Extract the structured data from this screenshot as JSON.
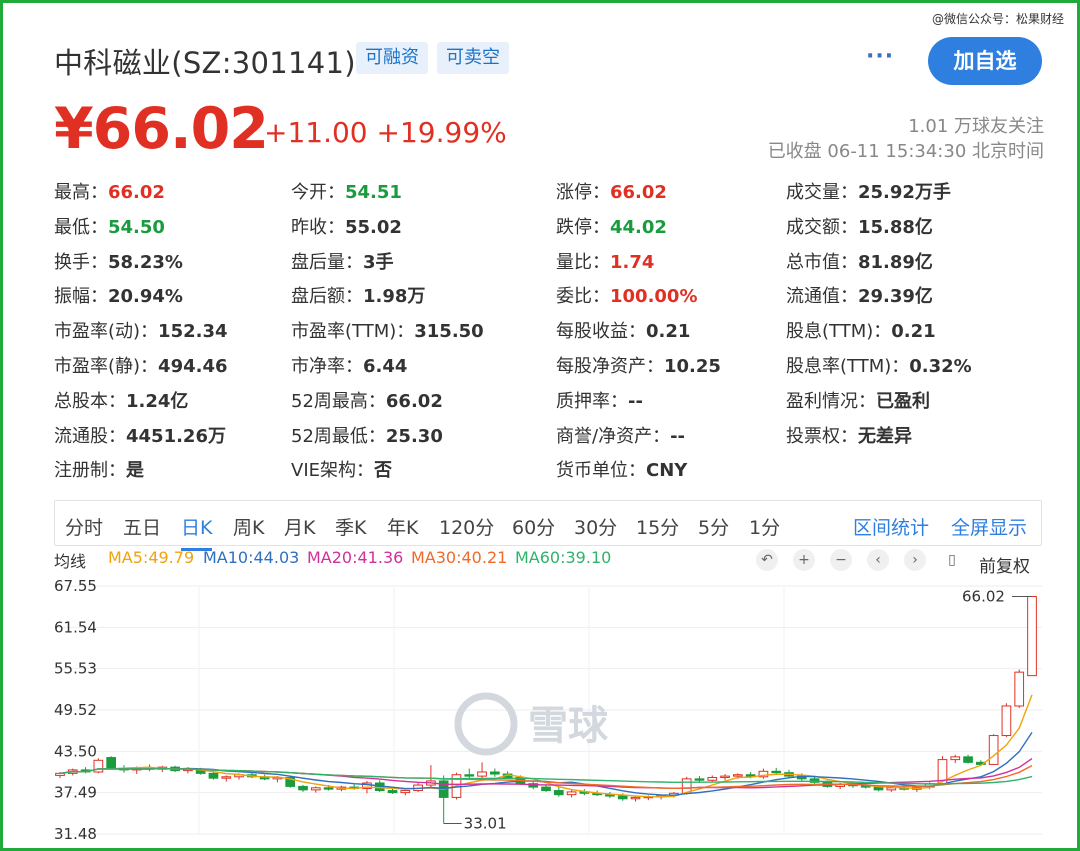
{
  "watermark_top": "@微信公众号：松果财经",
  "header": {
    "title": "中科磁业(SZ:301141)",
    "tags": [
      "可融资",
      "可卖空"
    ],
    "more_label": "···",
    "follow_label": "加自选"
  },
  "quote": {
    "price": "¥66.02",
    "change": "+11.00 +19.99%",
    "followers": "1.01 万球友关注",
    "status": "已收盘 06-11 15:34:30 北京时间"
  },
  "stats": [
    [
      {
        "label": "最高：",
        "value": "66.02",
        "color": "red"
      },
      {
        "label": "今开：",
        "value": "54.51",
        "color": "green"
      },
      {
        "label": "涨停：",
        "value": "66.02",
        "color": "red"
      },
      {
        "label": "成交量：",
        "value": "25.92万手",
        "color": ""
      }
    ],
    [
      {
        "label": "最低：",
        "value": "54.50",
        "color": "green"
      },
      {
        "label": "昨收：",
        "value": "55.02",
        "color": ""
      },
      {
        "label": "跌停：",
        "value": "44.02",
        "color": "green"
      },
      {
        "label": "成交额：",
        "value": "15.88亿",
        "color": ""
      }
    ],
    [
      {
        "label": "换手：",
        "value": "58.23%",
        "color": ""
      },
      {
        "label": "盘后量：",
        "value": "3手",
        "color": ""
      },
      {
        "label": "量比：",
        "value": "1.74",
        "color": "red"
      },
      {
        "label": "总市值：",
        "value": "81.89亿",
        "color": ""
      }
    ],
    [
      {
        "label": "振幅：",
        "value": "20.94%",
        "color": ""
      },
      {
        "label": "盘后额：",
        "value": "1.98万",
        "color": ""
      },
      {
        "label": "委比：",
        "value": "100.00%",
        "color": "red"
      },
      {
        "label": "流通值：",
        "value": "29.39亿",
        "color": ""
      }
    ],
    [
      {
        "label": "市盈率(动)：",
        "value": "152.34",
        "color": ""
      },
      {
        "label": "市盈率(TTM)：",
        "value": "315.50",
        "color": ""
      },
      {
        "label": "每股收益：",
        "value": "0.21",
        "color": ""
      },
      {
        "label": "股息(TTM)：",
        "value": "0.21",
        "color": ""
      }
    ],
    [
      {
        "label": "市盈率(静)：",
        "value": "494.46",
        "color": ""
      },
      {
        "label": "市净率：",
        "value": "6.44",
        "color": ""
      },
      {
        "label": "每股净资产：",
        "value": "10.25",
        "color": ""
      },
      {
        "label": "股息率(TTM)：",
        "value": "0.32%",
        "color": ""
      }
    ],
    [
      {
        "label": "总股本：",
        "value": "1.24亿",
        "color": ""
      },
      {
        "label": "52周最高：",
        "value": "66.02",
        "color": ""
      },
      {
        "label": "质押率：",
        "value": "--",
        "color": ""
      },
      {
        "label": "盈利情况：",
        "value": "已盈利",
        "color": ""
      }
    ],
    [
      {
        "label": "流通股：",
        "value": "4451.26万",
        "color": ""
      },
      {
        "label": "52周最低：",
        "value": "25.30",
        "color": ""
      },
      {
        "label": "商誉/净资产：",
        "value": "--",
        "color": ""
      },
      {
        "label": "投票权：",
        "value": "无差异",
        "color": ""
      }
    ],
    [
      {
        "label": "注册制：",
        "value": "是",
        "color": ""
      },
      {
        "label": "VIE架构：",
        "value": "否",
        "color": ""
      },
      {
        "label": "货币单位：",
        "value": "CNY",
        "color": ""
      }
    ]
  ],
  "periods": [
    "分时",
    "五日",
    "日K",
    "周K",
    "月K",
    "季K",
    "年K",
    "120分",
    "60分",
    "30分",
    "15分",
    "5分",
    "1分"
  ],
  "active_period": "日K",
  "tools": {
    "range_stats": "区间统计",
    "fullscreen": "全屏显示"
  },
  "ma": {
    "label": "均线",
    "items": [
      {
        "text": "MA5:49.79",
        "color": "#f0a30a"
      },
      {
        "text": "MA10:44.03",
        "color": "#2f6fc0"
      },
      {
        "text": "MA20:41.36",
        "color": "#d0309a"
      },
      {
        "text": "MA30:40.21",
        "color": "#f06a2a"
      },
      {
        "text": "MA60:39.10",
        "color": "#2fb36a"
      }
    ]
  },
  "chart_controls": {
    "icons": [
      "undo-icon",
      "zoom-in-icon",
      "zoom-out-icon",
      "prev-icon",
      "next-icon",
      "candle-icon"
    ],
    "adjust_label": "前复权"
  },
  "chart_watermark": "雪球",
  "chart_data": {
    "type": "candlestick",
    "y_ticks": [
      "67.55",
      "61.54",
      "55.53",
      "49.52",
      "43.50",
      "37.49",
      "31.48"
    ],
    "ylim": [
      31.48,
      67.55
    ],
    "annotations": [
      {
        "text": "66.02",
        "value": 66.02
      },
      {
        "text": "33.01",
        "value": 33.01
      }
    ],
    "colors": {
      "up": "#e03023",
      "down": "#1a9c3e"
    },
    "candles": [
      [
        40.0,
        40.5,
        39.6,
        40.3
      ],
      [
        40.3,
        41.0,
        40.0,
        40.8
      ],
      [
        40.8,
        41.2,
        40.3,
        40.5
      ],
      [
        40.5,
        42.5,
        40.3,
        42.2
      ],
      [
        42.6,
        42.8,
        40.9,
        41.0
      ],
      [
        41.0,
        41.5,
        40.4,
        40.8
      ],
      [
        40.8,
        41.3,
        40.2,
        41.1
      ],
      [
        41.1,
        41.6,
        40.6,
        40.9
      ],
      [
        40.9,
        41.4,
        40.5,
        41.2
      ],
      [
        41.2,
        41.4,
        40.5,
        40.7
      ],
      [
        40.7,
        41.2,
        40.3,
        40.9
      ],
      [
        40.9,
        41.1,
        40.1,
        40.3
      ],
      [
        40.3,
        40.6,
        39.4,
        39.6
      ],
      [
        39.6,
        40.0,
        39.1,
        39.8
      ],
      [
        39.8,
        40.3,
        39.4,
        40.1
      ],
      [
        40.1,
        40.5,
        39.6,
        39.8
      ],
      [
        39.8,
        40.1,
        39.3,
        39.5
      ],
      [
        39.5,
        39.9,
        39.0,
        39.7
      ],
      [
        39.7,
        39.9,
        38.2,
        38.4
      ],
      [
        38.4,
        38.6,
        37.6,
        37.9
      ],
      [
        37.9,
        38.4,
        37.5,
        38.2
      ],
      [
        38.2,
        38.6,
        37.8,
        38.0
      ],
      [
        38.0,
        38.5,
        37.7,
        38.3
      ],
      [
        38.3,
        38.7,
        37.9,
        38.1
      ],
      [
        38.1,
        39.2,
        37.4,
        38.9
      ],
      [
        38.9,
        39.3,
        37.6,
        37.8
      ],
      [
        37.8,
        38.1,
        37.3,
        37.5
      ],
      [
        37.5,
        37.9,
        37.1,
        37.8
      ],
      [
        37.8,
        38.9,
        37.6,
        38.6
      ],
      [
        38.6,
        41.5,
        38.3,
        39.2
      ],
      [
        39.2,
        40.0,
        33.01,
        36.8
      ],
      [
        36.8,
        40.4,
        36.5,
        40.1
      ],
      [
        40.1,
        41.0,
        39.4,
        39.9
      ],
      [
        39.9,
        41.9,
        39.6,
        40.5
      ],
      [
        40.5,
        41.0,
        39.8,
        40.2
      ],
      [
        40.2,
        40.6,
        39.5,
        39.7
      ],
      [
        39.7,
        40.0,
        38.6,
        38.8
      ],
      [
        38.8,
        39.2,
        38.0,
        38.3
      ],
      [
        38.3,
        38.7,
        37.6,
        37.8
      ],
      [
        37.8,
        38.4,
        36.9,
        37.2
      ],
      [
        37.2,
        37.9,
        36.8,
        37.6
      ],
      [
        37.6,
        38.0,
        37.1,
        37.4
      ],
      [
        37.4,
        37.8,
        37.0,
        37.2
      ],
      [
        37.2,
        37.6,
        36.7,
        37.0
      ],
      [
        37.0,
        37.4,
        36.3,
        36.6
      ],
      [
        36.6,
        37.0,
        36.2,
        36.8
      ],
      [
        36.8,
        37.1,
        36.4,
        36.9
      ],
      [
        36.9,
        37.2,
        36.5,
        37.1
      ],
      [
        37.1,
        37.6,
        36.8,
        37.4
      ],
      [
        37.4,
        39.8,
        37.2,
        39.5
      ],
      [
        39.5,
        39.9,
        38.9,
        39.3
      ],
      [
        39.3,
        40.0,
        39.0,
        39.7
      ],
      [
        39.7,
        40.2,
        39.3,
        39.9
      ],
      [
        39.9,
        40.3,
        39.5,
        40.1
      ],
      [
        40.1,
        40.5,
        39.6,
        39.8
      ],
      [
        39.8,
        41.0,
        39.5,
        40.6
      ],
      [
        40.6,
        41.1,
        40.1,
        40.4
      ],
      [
        40.4,
        40.8,
        39.7,
        39.9
      ],
      [
        39.9,
        40.3,
        39.2,
        39.5
      ],
      [
        39.5,
        39.8,
        38.8,
        39.0
      ],
      [
        39.0,
        39.3,
        38.2,
        38.4
      ],
      [
        38.4,
        38.9,
        38.0,
        38.7
      ],
      [
        38.7,
        39.0,
        38.2,
        38.5
      ],
      [
        38.5,
        38.9,
        38.1,
        38.3
      ],
      [
        38.3,
        38.6,
        37.7,
        37.9
      ],
      [
        37.9,
        38.4,
        37.6,
        38.2
      ],
      [
        38.2,
        38.5,
        37.8,
        38.0
      ],
      [
        38.0,
        38.4,
        37.6,
        38.3
      ],
      [
        38.3,
        39.0,
        38.0,
        38.8
      ],
      [
        38.8,
        42.8,
        38.6,
        42.3
      ],
      [
        42.3,
        43.0,
        41.8,
        42.7
      ],
      [
        42.7,
        43.0,
        41.7,
        41.9
      ],
      [
        41.9,
        42.2,
        41.4,
        41.6
      ],
      [
        41.6,
        46.0,
        41.6,
        45.8
      ],
      [
        45.8,
        50.5,
        45.6,
        50.1
      ],
      [
        50.1,
        55.4,
        49.8,
        55.02
      ],
      [
        54.51,
        66.02,
        54.5,
        66.02
      ]
    ],
    "ma5_end": 49.79,
    "ma10_end": 44.03,
    "ma20_end": 41.36,
    "ma30_end": 40.21,
    "ma60_end": 39.1
  }
}
